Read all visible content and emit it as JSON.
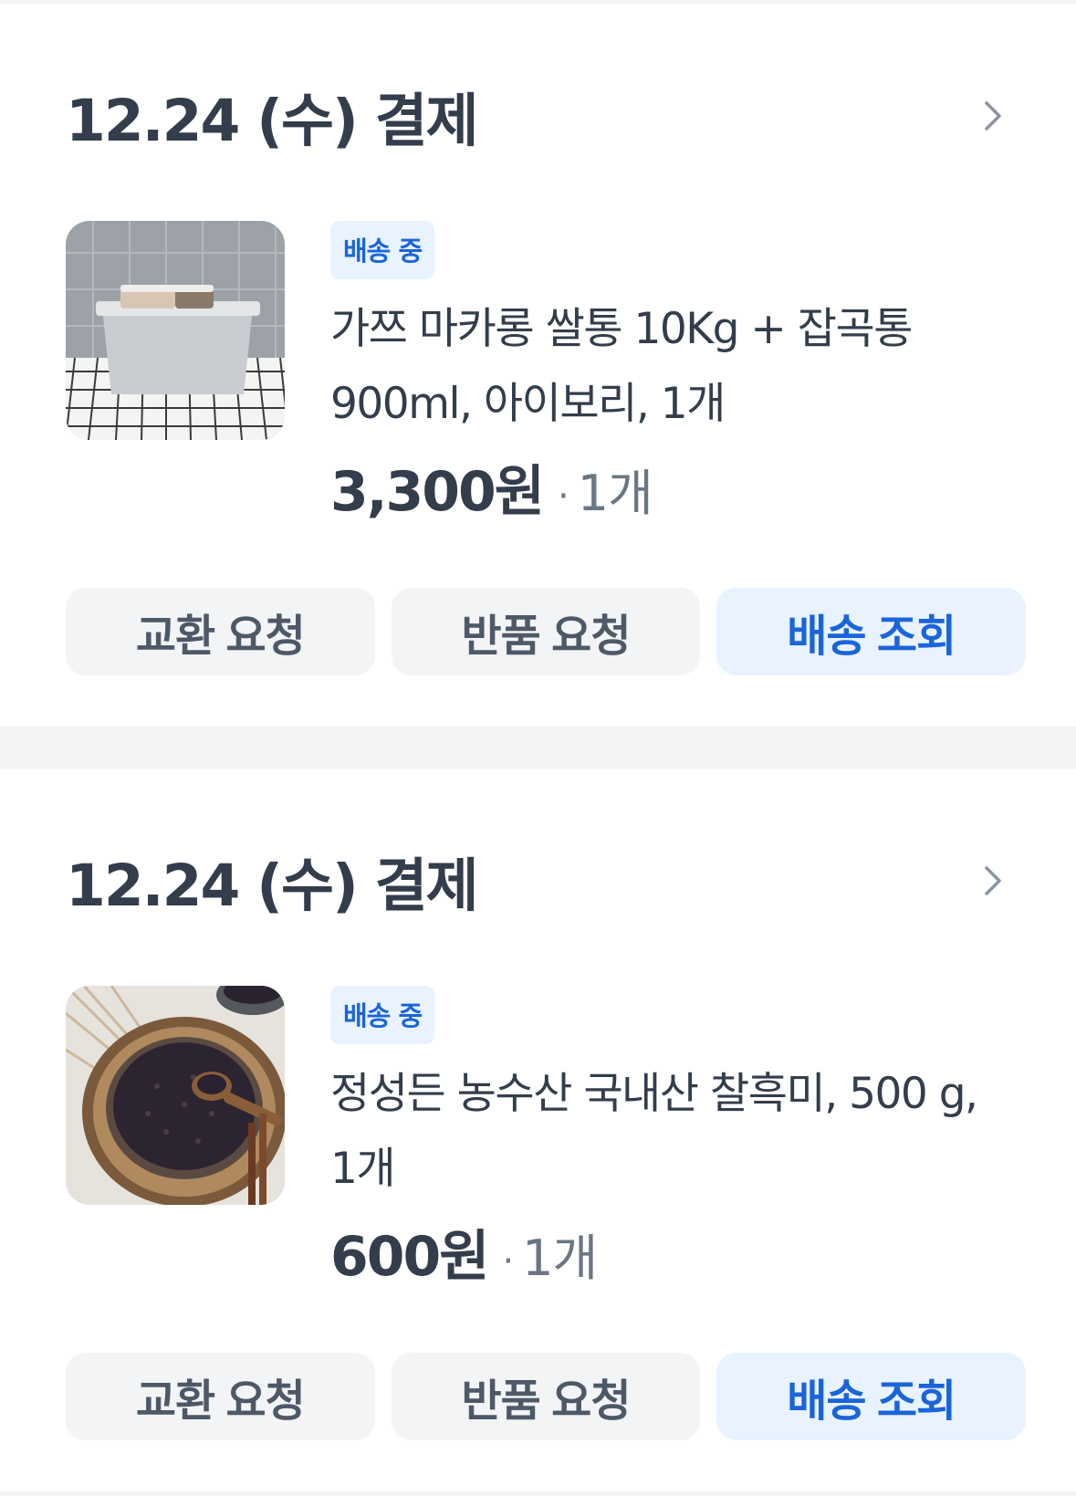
{
  "orders": [
    {
      "date_label": "12.24 (수) 결제",
      "status": "배송 중",
      "product_name": "가쯔 마카롱 쌀통 10Kg + 잡곡통 900ml, 아이보리, 1개",
      "price": "3,300원",
      "qty": "1개",
      "buttons": {
        "exchange": "교환 요청",
        "return": "반품 요청",
        "track": "배송 조회"
      },
      "thumbnail": "rice-container-product-image"
    },
    {
      "date_label": "12.24 (수) 결제",
      "status": "배송 중",
      "product_name": "정성든 농수산 국내산 찰흑미, 500 g, 1개",
      "price": "600원",
      "qty": "1개",
      "buttons": {
        "exchange": "교환 요청",
        "return": "반품 요청",
        "track": "배송 조회"
      },
      "thumbnail": "black-rice-product-image"
    }
  ],
  "icons": {
    "header_chevron": "chevron-right-icon",
    "qty_separator": "·"
  },
  "colors": {
    "background": "#f2f4f6",
    "card": "#ffffff",
    "text_primary": "#333d4b",
    "text_secondary": "#6b7684",
    "accent_blue": "#1b64da",
    "accent_blue_bg": "#e8f3ff",
    "button_bg": "#f2f4f6"
  }
}
